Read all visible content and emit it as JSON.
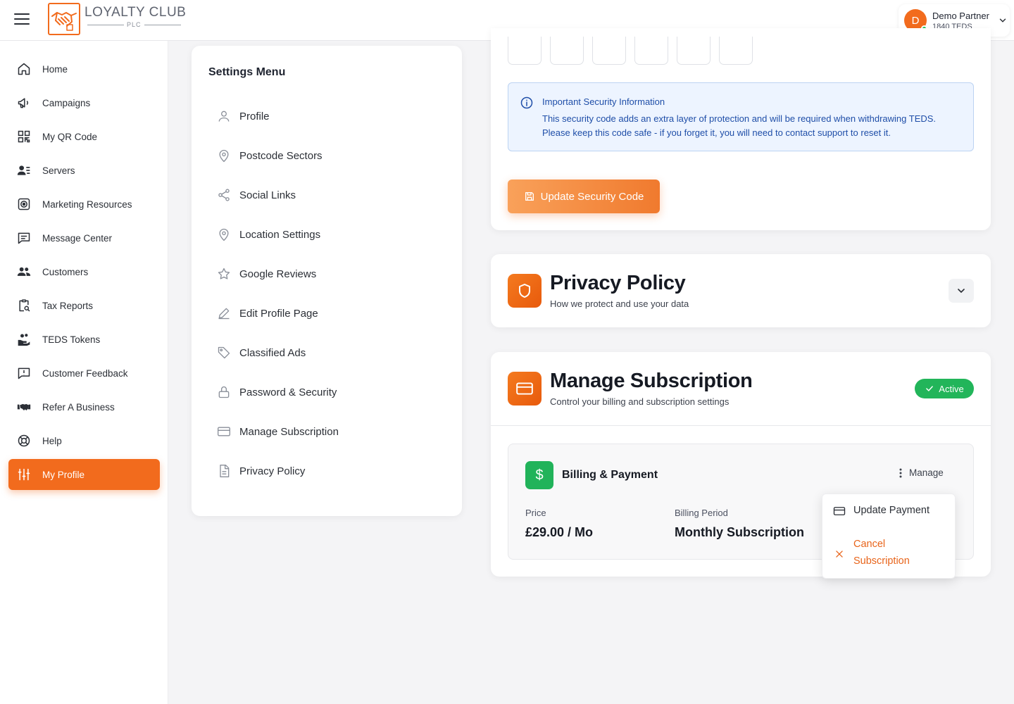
{
  "brand": {
    "title": "LOYALTY CLUB",
    "subtitle": "PLC",
    "accent": "#f26b1d"
  },
  "user": {
    "initial": "D",
    "name": "Demo Partner",
    "balance": "1840 TEDS"
  },
  "sidebar": {
    "items": [
      {
        "label": "Home",
        "icon": "home-icon"
      },
      {
        "label": "Campaigns",
        "icon": "megaphone-icon"
      },
      {
        "label": "My QR Code",
        "icon": "qr-code-icon"
      },
      {
        "label": "Servers",
        "icon": "user-list-icon"
      },
      {
        "label": "Marketing Resources",
        "icon": "target-icon"
      },
      {
        "label": "Message Center",
        "icon": "message-icon"
      },
      {
        "label": "Customers",
        "icon": "users-icon"
      },
      {
        "label": "Tax Reports",
        "icon": "clipboard-search-icon"
      },
      {
        "label": "TEDS Tokens",
        "icon": "coins-hand-icon"
      },
      {
        "label": "Customer Feedback",
        "icon": "feedback-icon"
      },
      {
        "label": "Refer A Business",
        "icon": "handshake-icon"
      },
      {
        "label": "Help",
        "icon": "lifebuoy-icon"
      },
      {
        "label": "My Profile",
        "icon": "sliders-icon",
        "active": true
      }
    ]
  },
  "settings_menu": {
    "title": "Settings Menu",
    "items": [
      {
        "label": "Profile",
        "icon": "user-icon"
      },
      {
        "label": "Postcode Sectors",
        "icon": "map-pin-icon"
      },
      {
        "label": "Social Links",
        "icon": "share-icon"
      },
      {
        "label": "Location Settings",
        "icon": "map-pin-icon"
      },
      {
        "label": "Google Reviews",
        "icon": "star-icon"
      },
      {
        "label": "Edit Profile Page",
        "icon": "pencil-icon"
      },
      {
        "label": "Classified Ads",
        "icon": "tag-icon"
      },
      {
        "label": "Password & Security",
        "icon": "lock-icon"
      },
      {
        "label": "Manage Subscription",
        "icon": "credit-card-icon"
      },
      {
        "label": "Privacy Policy",
        "icon": "document-icon"
      }
    ]
  },
  "security": {
    "info_title": "Important Security Information",
    "info_line1": "This security code adds an extra layer of protection and will be required when withdrawing TEDS.",
    "info_line2": "Please keep this code safe - if you forget it, you will need to contact support to reset it.",
    "update_button": "Update Security Code"
  },
  "privacy_policy": {
    "title": "Privacy Policy",
    "subtitle": "How we protect and use your data"
  },
  "subscription": {
    "title": "Manage Subscription",
    "subtitle": "Control your billing and subscription settings",
    "status": "Active",
    "billing_title": "Billing & Payment",
    "manage_label": "Manage",
    "price_label": "Price",
    "price_value": "£29.00 / Mo",
    "period_label": "Billing Period",
    "period_value": "Monthly Subscription",
    "menu": {
      "update_payment": "Update Payment",
      "cancel_line1": "Cancel",
      "cancel_line2": "Subscription"
    }
  }
}
